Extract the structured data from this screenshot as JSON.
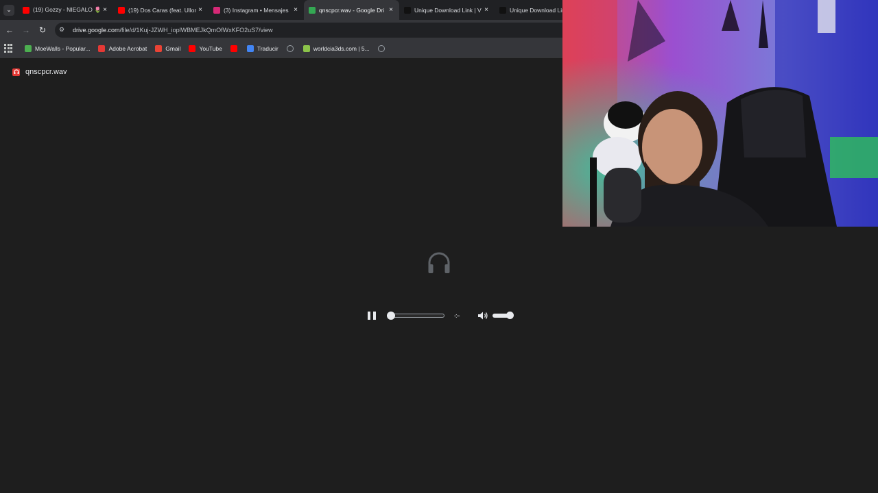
{
  "browser": {
    "tab_search_icon": "chevron-down-icon",
    "tabs": [
      {
        "title": "(19) Gozzy - NIEGALO 🌷",
        "favicon": "youtube-icon",
        "favicon_color": "#ff0000",
        "active": false
      },
      {
        "title": "(19) Dos Caras (feat. Ullon",
        "favicon": "youtube-icon",
        "favicon_color": "#ff0000",
        "active": false
      },
      {
        "title": "(3) Instagram • Mensajes",
        "favicon": "instagram-icon",
        "favicon_color": "#d62976",
        "active": false
      },
      {
        "title": "qnscpcr.wav - Google Dri",
        "favicon": "google-drive-icon",
        "favicon_color": "#34a853",
        "active": true
      },
      {
        "title": "Unique Download Link | V",
        "favicon": "unique-icon",
        "favicon_color": "#111111",
        "active": false
      },
      {
        "title": "Unique Download Link",
        "favicon": "unique-icon",
        "favicon_color": "#111111",
        "active": false
      }
    ],
    "close_glyph": "×",
    "url": {
      "host": "drive.google.com",
      "path": "/file/d/1Kuj-JZWH_ioplWBMEJkQmOfWxKFO2uS7/view"
    },
    "bookmarks": [
      {
        "label": "MoeWalls - Popular...",
        "favicon": "moewalls-icon",
        "color": "#4caf50"
      },
      {
        "label": "Adobe Acrobat",
        "favicon": "acrobat-icon",
        "color": "#e53935"
      },
      {
        "label": "Gmail",
        "favicon": "gmail-icon",
        "color": "#ea4335"
      },
      {
        "label": "YouTube",
        "favicon": "youtube-icon",
        "color": "#ff0000"
      },
      {
        "label": "",
        "favicon": "youtube-icon",
        "color": "#ff0000"
      },
      {
        "label": "Traducir",
        "favicon": "translate-icon",
        "color": "#4285f4"
      },
      {
        "label": "",
        "favicon": "globe-icon",
        "color": "#9aa0a6"
      },
      {
        "label": "worldcia3ds.com | 5...",
        "favicon": "worldcia-icon",
        "color": "#8bc34a"
      },
      {
        "label": "",
        "favicon": "globe-icon",
        "color": "#9aa0a6"
      }
    ]
  },
  "viewer": {
    "file_name": "qnscpcr.wav",
    "file_icon": "audio-file-icon",
    "file_icon_color": "#e53935",
    "preview_icon": "headphones-icon",
    "player": {
      "state": "playing",
      "progress_fraction": 0.0,
      "time_text": "-:--",
      "volume_fraction": 1.0
    }
  },
  "colors": {
    "background": "#1e1e1e",
    "tab_strip": "#202124",
    "toolbar": "#35363a"
  }
}
